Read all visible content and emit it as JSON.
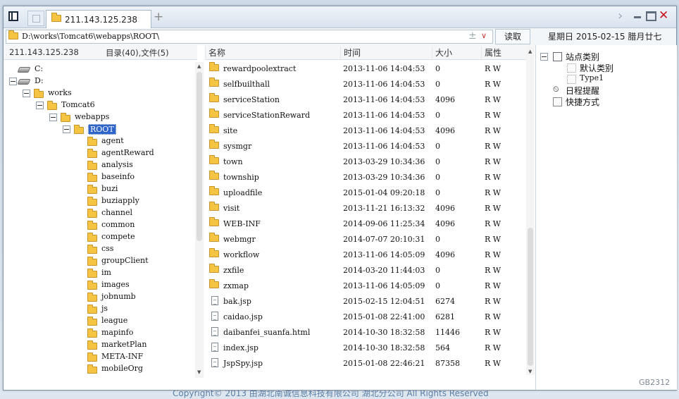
{
  "window": {
    "tab_title": "211.143.125.238",
    "new_tab_symbol": "+",
    "close_symbol": "✕"
  },
  "address_bar": {
    "path": "D:\\works\\Tomcat6\\webapps\\ROOT\\",
    "plus_symbol": "±",
    "dropdown_symbol": "∨",
    "read_button": "读取",
    "date_text": "星期日  2015-02-15  腊月廿七"
  },
  "tree": {
    "host": "211.143.125.238",
    "summary": "目录(40),文件(5)",
    "nodes": [
      {
        "label": "C:",
        "type": "drive",
        "level": 0
      },
      {
        "label": "D:",
        "type": "drive",
        "level": 0,
        "expanded": true
      },
      {
        "label": "works",
        "type": "folder",
        "level": 1,
        "expanded": true
      },
      {
        "label": "Tomcat6",
        "type": "folder",
        "level": 2,
        "expanded": true
      },
      {
        "label": "webapps",
        "type": "folder",
        "level": 3,
        "expanded": true
      },
      {
        "label": "ROOT",
        "type": "folder",
        "level": 4,
        "expanded": true,
        "selected": true
      },
      {
        "label": "agent",
        "type": "folder",
        "level": 5
      },
      {
        "label": "agentReward",
        "type": "folder",
        "level": 5
      },
      {
        "label": "analysis",
        "type": "folder",
        "level": 5
      },
      {
        "label": "baseinfo",
        "type": "folder",
        "level": 5
      },
      {
        "label": "buzi",
        "type": "folder",
        "level": 5
      },
      {
        "label": "buziapply",
        "type": "folder",
        "level": 5
      },
      {
        "label": "channel",
        "type": "folder",
        "level": 5
      },
      {
        "label": "common",
        "type": "folder",
        "level": 5
      },
      {
        "label": "compete",
        "type": "folder",
        "level": 5
      },
      {
        "label": "css",
        "type": "folder",
        "level": 5
      },
      {
        "label": "groupClient",
        "type": "folder",
        "level": 5
      },
      {
        "label": "im",
        "type": "folder",
        "level": 5
      },
      {
        "label": "images",
        "type": "folder",
        "level": 5
      },
      {
        "label": "jobnumb",
        "type": "folder",
        "level": 5
      },
      {
        "label": "js",
        "type": "folder",
        "level": 5
      },
      {
        "label": "league",
        "type": "folder",
        "level": 5
      },
      {
        "label": "mapinfo",
        "type": "folder",
        "level": 5
      },
      {
        "label": "marketPlan",
        "type": "folder",
        "level": 5
      },
      {
        "label": "META-INF",
        "type": "folder",
        "level": 5
      },
      {
        "label": "mobileOrg",
        "type": "folder",
        "level": 5
      }
    ]
  },
  "list": {
    "columns": [
      "名称",
      "时间",
      "大小",
      "属性"
    ],
    "rows": [
      {
        "name": "rewardpoolextract",
        "time": "2013-11-06 14:04:53",
        "size": "0",
        "attr": "R W",
        "type": "folder"
      },
      {
        "name": "selfbuilthall",
        "time": "2013-11-06 14:04:53",
        "size": "0",
        "attr": "R W",
        "type": "folder"
      },
      {
        "name": "serviceStation",
        "time": "2013-11-06 14:04:53",
        "size": "4096",
        "attr": "R W",
        "type": "folder"
      },
      {
        "name": "serviceStationReward",
        "time": "2013-11-06 14:04:53",
        "size": "0",
        "attr": "R W",
        "type": "folder"
      },
      {
        "name": "site",
        "time": "2013-11-06 14:04:53",
        "size": "4096",
        "attr": "R W",
        "type": "folder"
      },
      {
        "name": "sysmgr",
        "time": "2013-11-06 14:04:53",
        "size": "0",
        "attr": "R W",
        "type": "folder"
      },
      {
        "name": "town",
        "time": "2013-03-29 10:34:36",
        "size": "0",
        "attr": "R W",
        "type": "folder"
      },
      {
        "name": "township",
        "time": "2013-03-29 10:34:36",
        "size": "0",
        "attr": "R W",
        "type": "folder"
      },
      {
        "name": "uploadfile",
        "time": "2015-01-04 09:20:18",
        "size": "0",
        "attr": "R W",
        "type": "folder"
      },
      {
        "name": "visit",
        "time": "2013-11-21 16:13:32",
        "size": "4096",
        "attr": "R W",
        "type": "folder"
      },
      {
        "name": "WEB-INF",
        "time": "2014-09-06 11:25:34",
        "size": "4096",
        "attr": "R W",
        "type": "folder"
      },
      {
        "name": "webmgr",
        "time": "2014-07-07 20:10:31",
        "size": "0",
        "attr": "R W",
        "type": "folder"
      },
      {
        "name": "workflow",
        "time": "2013-11-06 14:05:09",
        "size": "4096",
        "attr": "R W",
        "type": "folder"
      },
      {
        "name": "zxfile",
        "time": "2014-03-20 11:44:03",
        "size": "0",
        "attr": "R W",
        "type": "folder"
      },
      {
        "name": "zxmap",
        "time": "2013-11-06 14:05:09",
        "size": "0",
        "attr": "R W",
        "type": "folder"
      },
      {
        "name": "bak.jsp",
        "time": "2015-02-15 12:04:51",
        "size": "6274",
        "attr": "R W",
        "type": "file"
      },
      {
        "name": "caidao.jsp",
        "time": "2015-01-08 22:41:00",
        "size": "6281",
        "attr": "R W",
        "type": "file"
      },
      {
        "name": "daibanfei_suanfa.html",
        "time": "2014-10-30 18:32:58",
        "size": "11446",
        "attr": "R W",
        "type": "file"
      },
      {
        "name": "index.jsp",
        "time": "2014-10-30 18:32:58",
        "size": "564",
        "attr": "R W",
        "type": "file"
      },
      {
        "name": "JspSpy.jsp",
        "time": "2015-01-08 22:46:21",
        "size": "87358",
        "attr": "R W",
        "type": "file"
      }
    ]
  },
  "right_panel": {
    "site_category": "站点类别",
    "default_category": "默认类别",
    "type1": "Type1",
    "schedule": "日程提醒",
    "shortcuts": "快捷方式"
  },
  "watermark": "GB2312",
  "footer_text": "Copyright© 2013 由湖北南诚信息科技有限公司 湖北分公司 All Rights Reserved"
}
